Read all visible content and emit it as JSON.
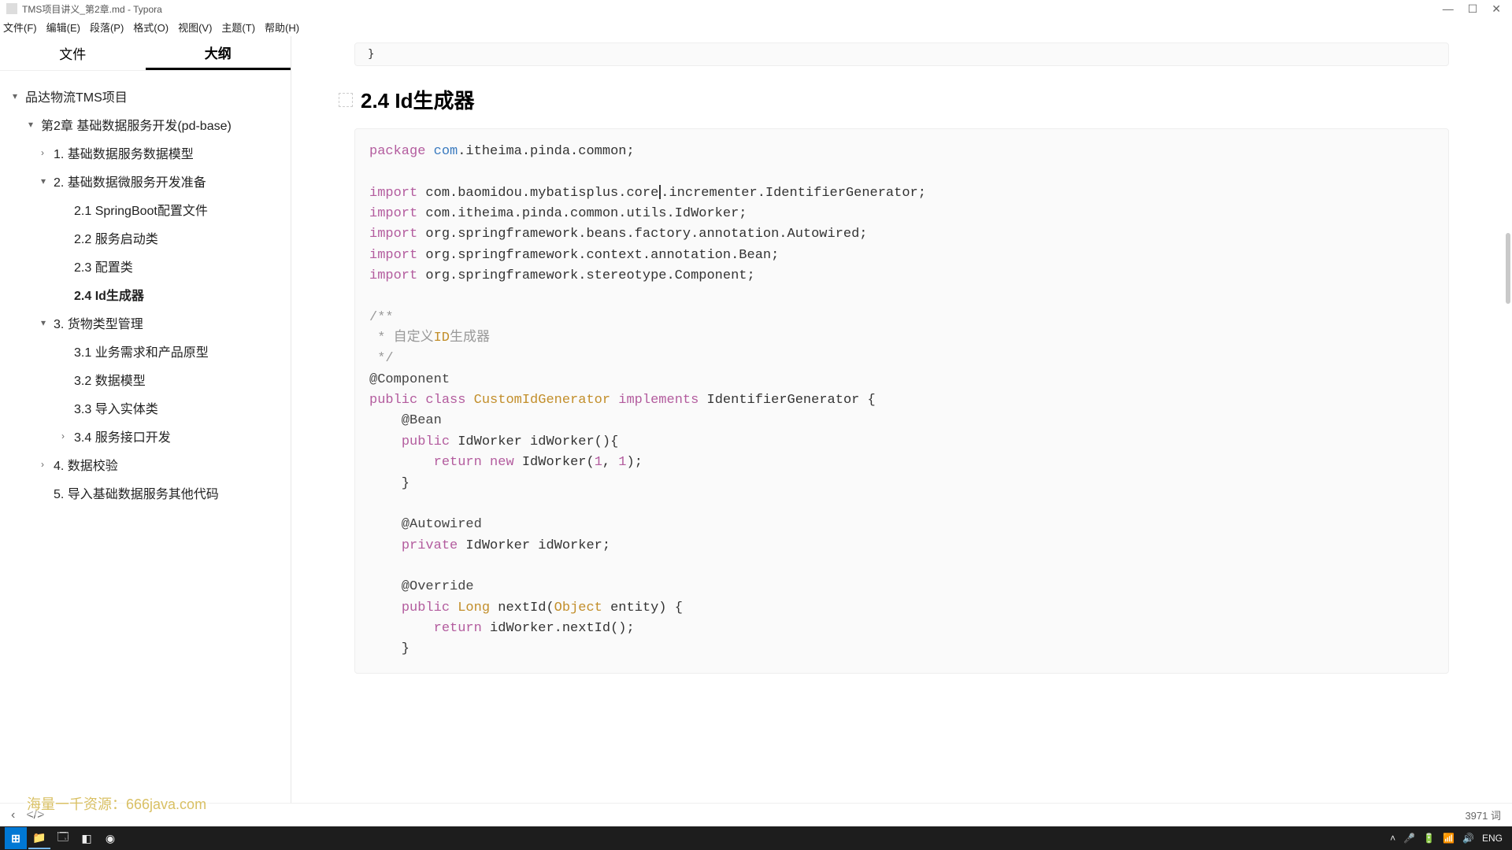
{
  "window": {
    "title": "TMS项目讲义_第2章.md - Typora"
  },
  "menu": {
    "file": "文件(F)",
    "edit": "编辑(E)",
    "paragraph": "段落(P)",
    "format": "格式(O)",
    "view": "视图(V)",
    "theme": "主题(T)",
    "help": "帮助(H)"
  },
  "sidebar": {
    "tabs": {
      "file": "文件",
      "outline": "大纲"
    },
    "tree": [
      {
        "level": 0,
        "label": "品达物流TMS项目",
        "toggle": "▾"
      },
      {
        "level": 1,
        "label": "第2章 基础数据服务开发(pd-base)",
        "toggle": "▾"
      },
      {
        "level": 2,
        "label": "1. 基础数据服务数据模型",
        "toggle": "›"
      },
      {
        "level": 2,
        "label": "2. 基础数据微服务开发准备",
        "toggle": "▾"
      },
      {
        "level": 3,
        "label": "2.1 SpringBoot配置文件",
        "toggle": ""
      },
      {
        "level": 3,
        "label": "2.2 服务启动类",
        "toggle": ""
      },
      {
        "level": 3,
        "label": "2.3 配置类",
        "toggle": ""
      },
      {
        "level": 3,
        "label": "2.4 Id生成器",
        "toggle": "",
        "active": true
      },
      {
        "level": 2,
        "label": "3. 货物类型管理",
        "toggle": "▾"
      },
      {
        "level": 3,
        "label": "3.1 业务需求和产品原型",
        "toggle": ""
      },
      {
        "level": 3,
        "label": "3.2 数据模型",
        "toggle": ""
      },
      {
        "level": 3,
        "label": "3.3 导入实体类",
        "toggle": ""
      },
      {
        "level": 3,
        "label": "3.4 服务接口开发",
        "toggle": "›"
      },
      {
        "level": 2,
        "label": "4. 数据校验",
        "toggle": "›"
      },
      {
        "level": 2,
        "label": "5. 导入基础数据服务其他代码",
        "toggle": ""
      }
    ]
  },
  "content": {
    "prev_tail": "}",
    "heading": "2.4 Id生成器",
    "code": {
      "package": "package",
      "package_name": "com",
      "package_rest": ".itheima.pinda.common;",
      "import": "import",
      "imp1": " com.baomidou.mybatisplus.core",
      "imp1b": ".incrementer.IdentifierGenerator;",
      "imp2": " com.itheima.pinda.common.utils.IdWorker;",
      "imp3": " org.springframework.beans.factory.annotation.Autowired;",
      "imp4": " org.springframework.context.annotation.Bean;",
      "imp5": " org.springframework.stereotype.Component;",
      "doc1": "/**",
      "doc2": " * 自定义",
      "doc2b": "ID",
      "doc2c": "生成器",
      "doc3": " */",
      "ann_component": "@Component",
      "public": "public",
      "class": "class",
      "class_name": "CustomIdGenerator",
      "implements": "implements",
      "iface": "IdentifierGenerator {",
      "ann_bean": "    @Bean",
      "idworker_sig1": "    ",
      "idworker_sig2": " IdWorker idWorker(){",
      "ret": "return",
      "new": "new",
      "idworker_new": " IdWorker(",
      "num1": "1",
      "comma": ", ",
      "num2": "1",
      "idworker_end": ");",
      "brace_close": "    }",
      "ann_autowired": "    @Autowired",
      "private": "private",
      "field": " IdWorker idWorker;",
      "ann_override": "    @Override",
      "long": "Long",
      "nextid_sig": " nextId(",
      "object": "Object",
      "nextid_sig2": " entity) {",
      "nextid_body": " idWorker.nextId();",
      "brace_close2": "    }"
    }
  },
  "status": {
    "wordcount": "3971 词"
  },
  "taskbar": {
    "lang": "ENG"
  },
  "watermark": "海量一千资源：666java.com"
}
